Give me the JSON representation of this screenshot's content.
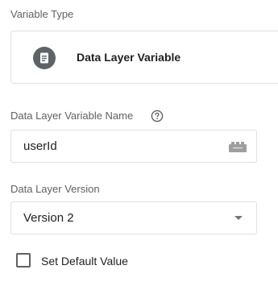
{
  "variable_type": {
    "label": "Variable Type",
    "selected": "Data Layer Variable",
    "icon": "variable-type-icon"
  },
  "dl_name": {
    "label": "Data Layer Variable Name",
    "help_icon": "help-icon",
    "value": "userId",
    "picker_icon": "building-block-icon"
  },
  "dl_version": {
    "label": "Data Layer Version",
    "selected": "Version 2",
    "arrow_icon": "dropdown-arrow-icon"
  },
  "default_value": {
    "label": "Set Default Value",
    "checked": false
  }
}
